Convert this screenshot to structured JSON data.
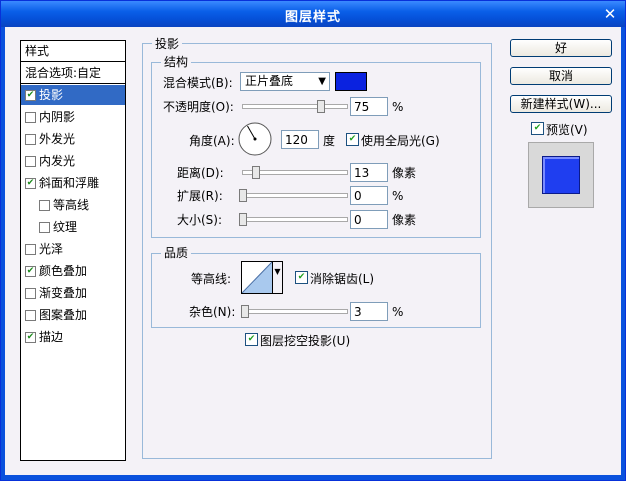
{
  "window": {
    "title": "图层样式",
    "close_glyph": "✕"
  },
  "styles_list": {
    "header": "样式",
    "blend_options": "混合选项:自定",
    "items": [
      {
        "label": "投影",
        "checked": true,
        "selected": true
      },
      {
        "label": "内阴影",
        "checked": false
      },
      {
        "label": "外发光",
        "checked": false
      },
      {
        "label": "内发光",
        "checked": false
      },
      {
        "label": "斜面和浮雕",
        "checked": true
      },
      {
        "label": "等高线",
        "checked": false,
        "indent": true
      },
      {
        "label": "纹理",
        "checked": false,
        "indent": true
      },
      {
        "label": "光泽",
        "checked": false
      },
      {
        "label": "颜色叠加",
        "checked": true
      },
      {
        "label": "渐变叠加",
        "checked": false
      },
      {
        "label": "图案叠加",
        "checked": false
      },
      {
        "label": "描边",
        "checked": true
      }
    ]
  },
  "shadow": {
    "title": "投影",
    "structure": {
      "title": "结构",
      "blend_mode_label": "混合模式(B):",
      "blend_mode_value": "正片叠底",
      "color": "#0a22e0",
      "opacity_label": "不透明度(O):",
      "opacity_value": "75",
      "opacity_unit": "%",
      "opacity_fraction": 0.75,
      "angle_label": "角度(A):",
      "angle_value": "120",
      "angle_unit": "度",
      "global_light_label": "使用全局光(G)",
      "global_light_checked": true,
      "distance_label": "距离(D):",
      "distance_value": "13",
      "distance_unit": "像素",
      "distance_fraction": 0.05,
      "spread_label": "扩展(R):",
      "spread_value": "0",
      "spread_unit": "%",
      "size_label": "大小(S):",
      "size_value": "0",
      "size_unit": "像素"
    },
    "quality": {
      "title": "品质",
      "contour_label": "等高线:",
      "antialias_label": "消除锯齿(L)",
      "antialias_checked": true,
      "noise_label": "杂色(N):",
      "noise_value": "3",
      "noise_unit": "%"
    },
    "knockout_label": "图层挖空投影(U)",
    "knockout_checked": true
  },
  "buttons": {
    "ok": "好",
    "cancel": "取消",
    "new_style": "新建样式(W)...",
    "preview_label": "预览(V)",
    "preview_checked": true,
    "preview_color": "#1f3ef0"
  },
  "check_glyph": "✔"
}
